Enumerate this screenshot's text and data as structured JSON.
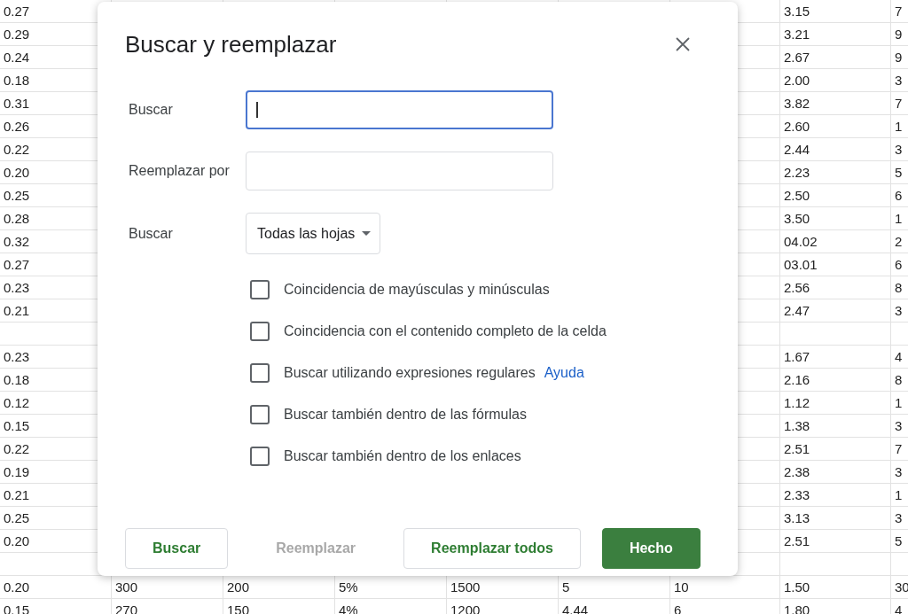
{
  "sheet": {
    "rows": [
      {
        "column_1": "0.27",
        "column_8": "3.15",
        "column_9": "7"
      },
      {
        "column_1": "0.29",
        "column_8": "3.21",
        "column_9": "9"
      },
      {
        "column_1": "0.24",
        "column_8": "2.67",
        "column_9": "9"
      },
      {
        "column_1": "0.18",
        "column_8": "2.00",
        "column_9": "3"
      },
      {
        "column_1": "0.31",
        "column_8": "3.82",
        "column_9": "7"
      },
      {
        "column_1": "0.26",
        "column_8": "2.60",
        "column_9": "1"
      },
      {
        "column_1": "0.22",
        "column_8": "2.44",
        "column_9": "3"
      },
      {
        "column_1": "0.20",
        "column_8": "2.23",
        "column_9": "5"
      },
      {
        "column_1": "0.25",
        "column_8": "2.50",
        "column_9": "6"
      },
      {
        "column_1": "0.28",
        "column_8": "3.50",
        "column_9": "1"
      },
      {
        "column_1": "0.32",
        "column_8": "04.02",
        "column_9": "2"
      },
      {
        "column_1": "0.27",
        "column_8": "03.01",
        "column_9": "6"
      },
      {
        "column_1": "0.23",
        "column_8": "2.56",
        "column_9": "8"
      },
      {
        "column_1": "0.21",
        "column_8": "2.47",
        "column_9": "3"
      },
      {},
      {
        "column_1": "0.23",
        "column_8": "1.67",
        "column_9": "4"
      },
      {
        "column_1": "0.18",
        "column_8": "2.16",
        "column_9": "8"
      },
      {
        "column_1": "0.12",
        "column_8": "1.12",
        "column_9": "1"
      },
      {
        "column_1": "0.15",
        "column_8": "1.38",
        "column_9": "3"
      },
      {
        "column_1": "0.22",
        "column_8": "2.51",
        "column_9": "7"
      },
      {
        "column_1": "0.19",
        "column_8": "2.38",
        "column_9": "3"
      },
      {
        "column_1": "0.21",
        "column_8": "2.33",
        "column_9": "1"
      },
      {
        "column_1": "0.25",
        "column_8": "3.13",
        "column_9": "3"
      },
      {
        "column_1": "0.20",
        "column_8": "2.51",
        "column_9": "5"
      },
      {},
      {
        "column_1": "0.20",
        "column_2": "300",
        "column_3": "200",
        "column_4": "5%",
        "column_5": "1500",
        "column_6": "5",
        "column_7": "10",
        "column_8": "1.50",
        "column_9": "30"
      },
      {
        "column_1": "0.15",
        "column_2": "270",
        "column_3": "150",
        "column_4": "4%",
        "column_5": "1200",
        "column_6": "4.44",
        "column_7": "6",
        "column_8": "1.80",
        "column_9": "4"
      }
    ]
  },
  "dialog": {
    "title": "Buscar y reemplazar",
    "fields": [
      {
        "kind": "text",
        "label": "Buscar",
        "focused": true
      },
      {
        "kind": "text",
        "label": "Reemplazar por",
        "focused": false
      },
      {
        "kind": "dropdown",
        "label": "Buscar",
        "value": "Todas las hojas"
      }
    ],
    "options": [
      {
        "label": "Coincidencia de mayúsculas y minúsculas",
        "checked": false
      },
      {
        "label": "Coincidencia con el contenido completo de la celda",
        "checked": false
      },
      {
        "label": "Buscar utilizando expresiones regulares",
        "checked": false,
        "link": "Ayuda"
      },
      {
        "label": "Buscar también dentro de las fórmulas",
        "checked": false
      },
      {
        "label": "Buscar también dentro de los enlaces",
        "checked": false
      }
    ],
    "buttons": [
      {
        "label": "Buscar",
        "kind": "outlined",
        "disabled": false
      },
      {
        "label": "Reemplazar",
        "kind": "text",
        "disabled": true
      },
      {
        "label": "Reemplazar todos",
        "kind": "outlined",
        "disabled": false
      },
      {
        "label": "Hecho",
        "kind": "filled",
        "disabled": false
      }
    ]
  }
}
